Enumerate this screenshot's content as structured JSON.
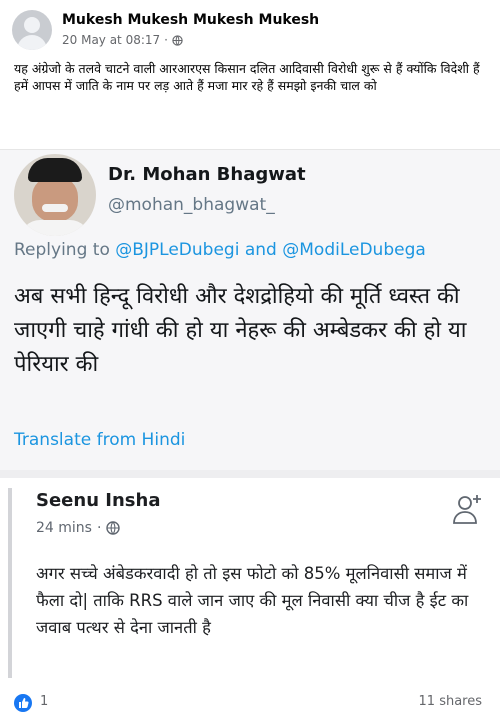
{
  "post": {
    "author": "Mukesh Mukesh Mukesh Mukesh",
    "timestamp": "20 May at 08:17",
    "separator": "·",
    "privacy_icon": "globe-icon",
    "text": "यह अंग्रेजो के तलवे चाटने वाली आरआरएस किसान दलित आदिवासी विरोधी शुरू से हैं क्योंकि विदेशी हैं हमें आपस में जाति के नाम पर लड़ आते हैं मजा मार रहे हैं समझो इनकी चाल को"
  },
  "tweet": {
    "display_name": "Dr. Mohan Bhagwat",
    "handle": "@mohan_bhagwat_",
    "reply_prefix": "Replying to",
    "reply_user_1": "@BJPLeDubegi",
    "reply_and": "and",
    "reply_user_2": "@ModiLeDubega",
    "body": "अब सभी हिन्दू विरोधी और देशद्रोहियो की मूर्ति ध्वस्त की जाएगी चाहे गांधी की हो या नेहरू की अम्बेडकर की हो या पेरियार की",
    "translate": "Translate from Hindi"
  },
  "comment": {
    "name": "Seenu Insha",
    "time": "24 mins",
    "separator": "·",
    "text": "अगर सच्चे अंबेडकरवादी हो तो इस फोटो को 85% मूलनिवासी समाज में फैला दो| ताकि RRS वाले जान जाए की मूल निवासी क्या चीज है ईट का जवाब पत्थर से देना जानती है"
  },
  "footer": {
    "like_count": "1",
    "shares": "11 shares"
  },
  "colors": {
    "link_blue": "#1b95e0",
    "facebook_blue": "#1877f2",
    "secondary_text": "#65676b"
  }
}
